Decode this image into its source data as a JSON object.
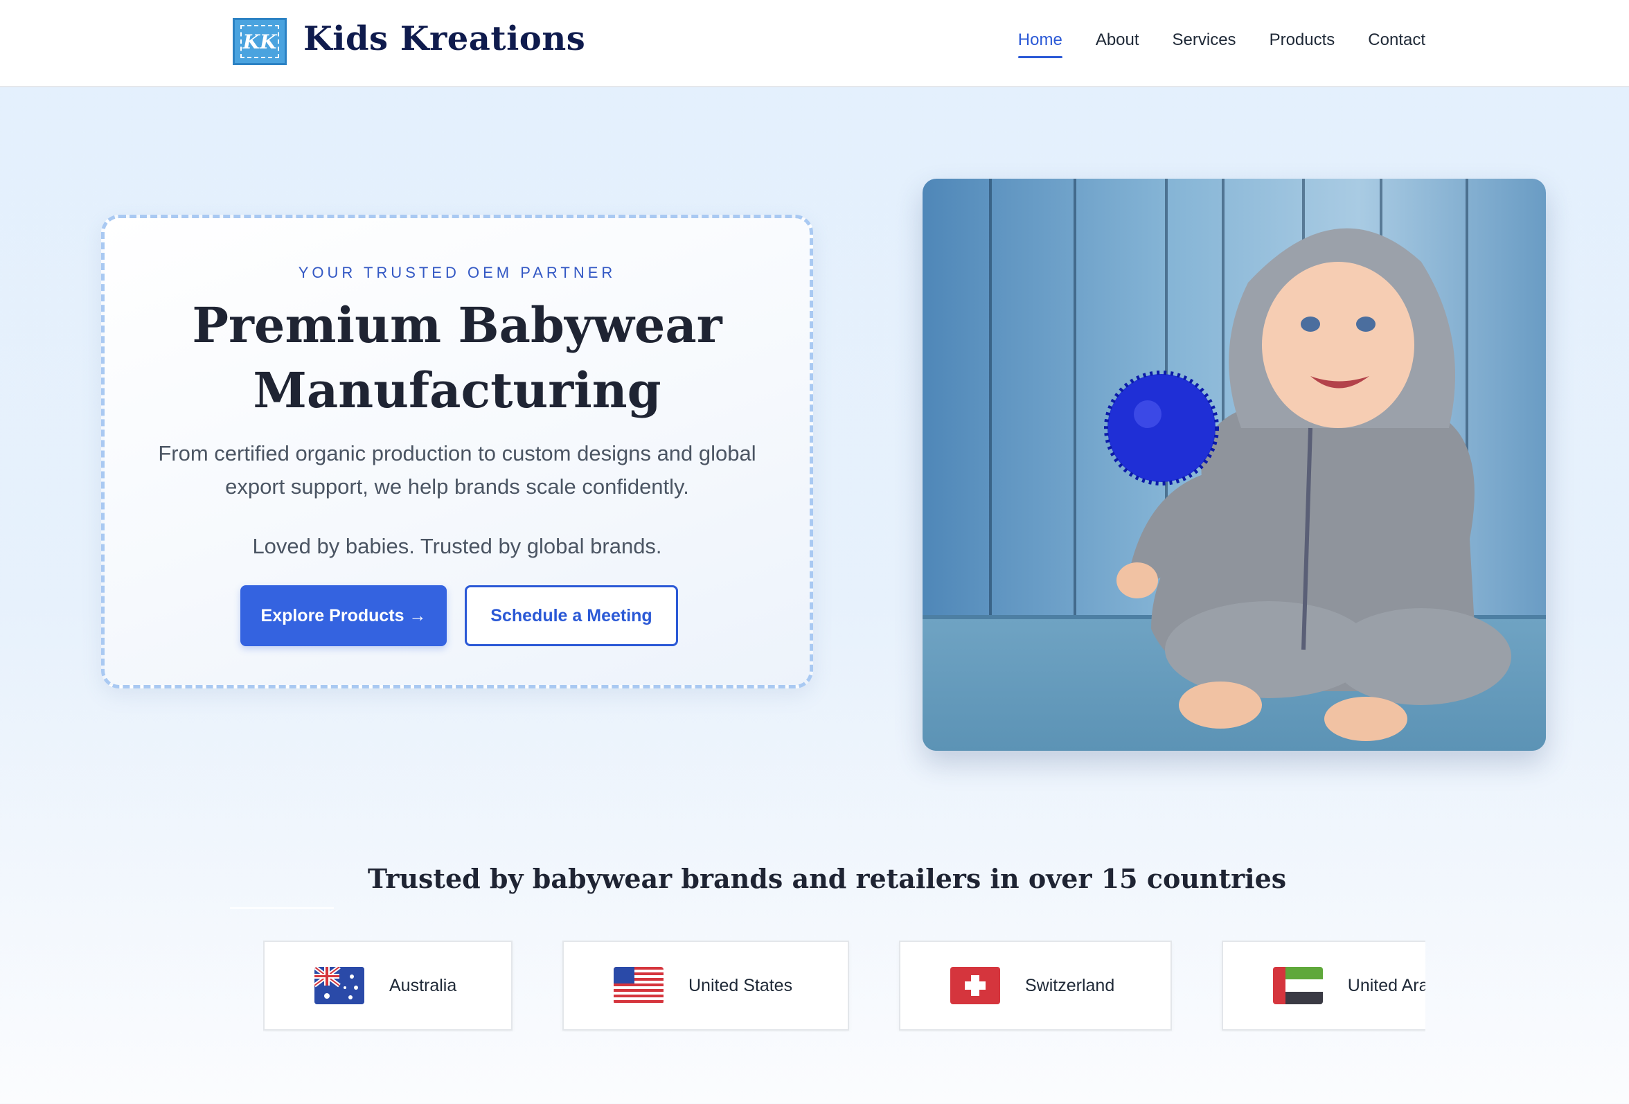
{
  "header": {
    "logo_text": "KK",
    "brand": "Kids Kreations",
    "nav": [
      "Home",
      "About",
      "Services",
      "Products",
      "Contact"
    ],
    "active_nav": "Home"
  },
  "hero": {
    "eyebrow": "YOUR TRUSTED OEM PARTNER",
    "title": "Premium Babywear Manufacturing",
    "description": "From certified organic production to custom designs and global export support, we help brands scale confidently.",
    "tagline": "Loved by babies. Trusted by global brands.",
    "primary_button": "Explore Products →",
    "secondary_button": "Schedule a Meeting",
    "image_description": "toddler-in-grey-hoodie-holding-blue-ball"
  },
  "trusted": {
    "title": "Trusted by babywear brands and retailers in over 15 countries",
    "countries": [
      {
        "name": "Australia",
        "flag": "australia-flag"
      },
      {
        "name": "United States",
        "flag": "us-flag"
      },
      {
        "name": "Switzerland",
        "flag": "switzerland-flag"
      },
      {
        "name": "United Arab Emirates",
        "flag": "uae-flag"
      }
    ]
  },
  "colors": {
    "accent": "#3463e0",
    "brand_text": "#0f1b4d",
    "background": "#e3f0fd"
  }
}
